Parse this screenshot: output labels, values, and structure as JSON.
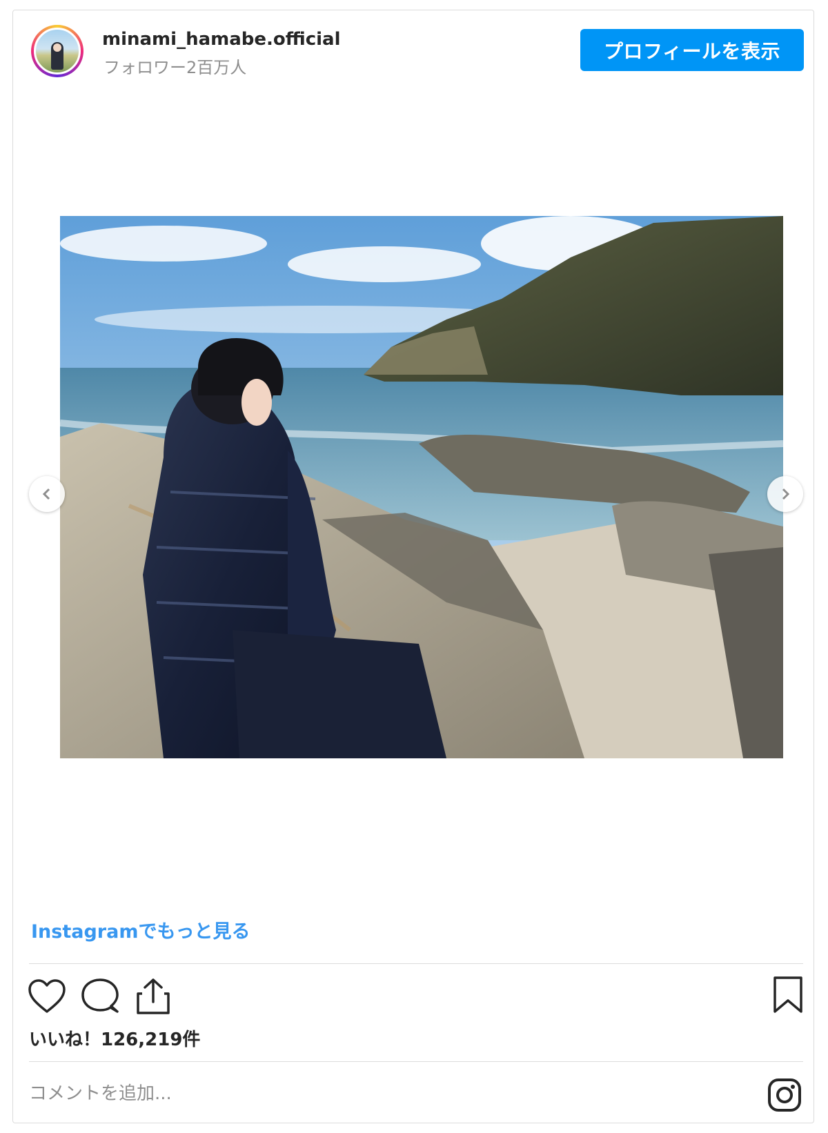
{
  "header": {
    "username": "minami_hamabe.official",
    "followers": "フォロワー2百万人",
    "profile_button": "プロフィールを表示"
  },
  "post": {
    "more_link": "Instagramでもっと見る",
    "likes": "いいね！126,219件",
    "comment_placeholder": "コメントを追加..."
  },
  "icons": {
    "avatar": "profile-avatar",
    "nav_prev": "chevron-left-icon",
    "nav_next": "chevron-right-icon",
    "like": "heart-icon",
    "comment": "comment-bubble-icon",
    "share": "share-icon",
    "save": "bookmark-icon",
    "brand": "instagram-icon"
  },
  "colors": {
    "accent": "#0095f6",
    "link": "#3897f0",
    "muted": "#8e8e8e",
    "border": "#dbdbdb"
  }
}
